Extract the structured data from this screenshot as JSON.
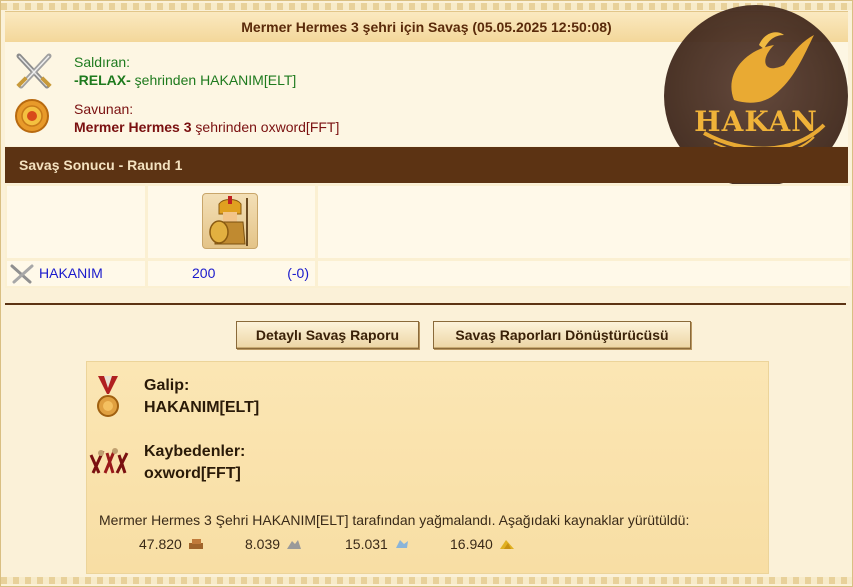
{
  "header": {
    "title": "Mermer Hermes 3 şehri için Savaş (05.05.2025 12:50:08)"
  },
  "attacker": {
    "label": "Saldıran:",
    "city": "-RELAX-",
    "middle": " şehrinden ",
    "player": "HAKANIM[ELT]"
  },
  "defender": {
    "label": "Savunan:",
    "city": "Mermer Hermes 3",
    "middle": " şehrinden ",
    "player": "oxword[FFT]"
  },
  "result": {
    "title": "Savaş Sonucu - Raund 1"
  },
  "units_row": {
    "player": "HAKANIM",
    "count": "200",
    "loss": "(-0)"
  },
  "buttons": {
    "detailed_report": "Detaylı Savaş Raporu",
    "converter": "Savaş Raporları Dönüştürücüsü"
  },
  "summary": {
    "winner_label": "Galip:",
    "winner": "HAKANIM[ELT]",
    "losers_label": "Kaybedenler:",
    "loser": "oxword[FFT]",
    "plunder_text": "Mermer Hermes 3 Şehri HAKANIM[ELT] tarafından yağmalandı. Aşağıdaki kaynaklar yürütüldü:",
    "resources": [
      {
        "amount": "47.820",
        "icon": "wood-icon"
      },
      {
        "amount": "8.039",
        "icon": "marble-icon"
      },
      {
        "amount": "15.031",
        "icon": "crystal-icon"
      },
      {
        "amount": "16.940",
        "icon": "sulfur-icon"
      }
    ]
  },
  "watermark": {
    "text": "HAKAN"
  },
  "colors": {
    "header_dark": "#5c3313",
    "attacker": "#1e7a1e",
    "defender": "#7a1010",
    "link": "#1a1acc"
  }
}
